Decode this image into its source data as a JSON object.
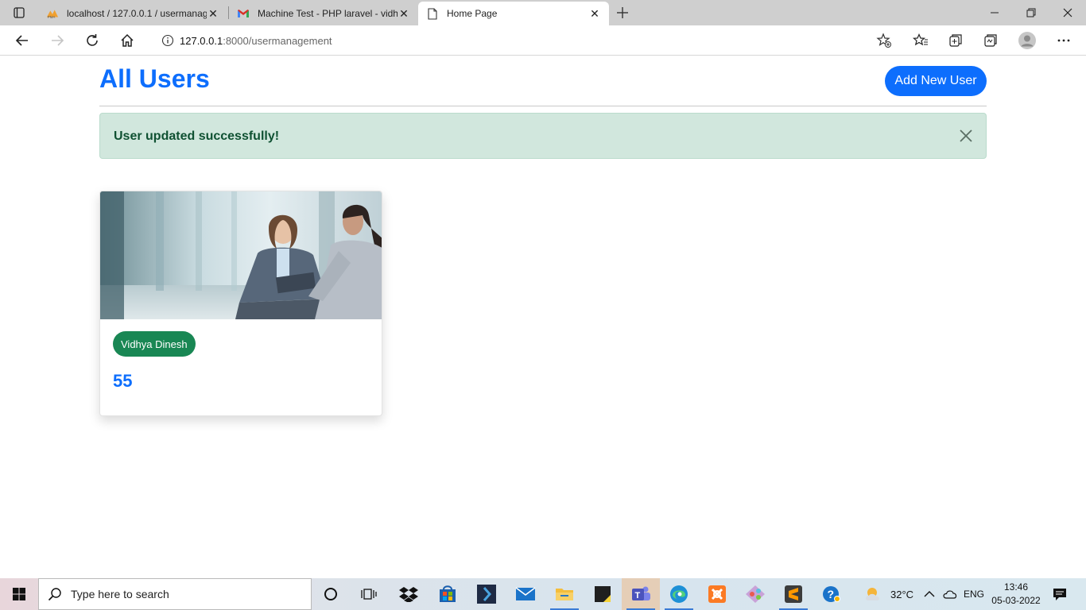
{
  "browser": {
    "tabs": [
      {
        "title": "localhost / 127.0.0.1 / usermanag",
        "icon": "phpmyadmin-icon",
        "active": false
      },
      {
        "title": "Machine Test - PHP laravel - vidh",
        "icon": "gmail-icon",
        "active": false
      },
      {
        "title": "Home Page",
        "icon": "page-icon",
        "active": true
      }
    ],
    "address": {
      "host": "127.0.0.1",
      "path": ":8000/usermanagement"
    }
  },
  "page": {
    "title": "All Users",
    "add_button": "Add New User",
    "alert": "User updated successfully!",
    "users": [
      {
        "name": "Vidhya Dinesh",
        "number": "55"
      }
    ]
  },
  "taskbar": {
    "search_placeholder": "Type here to search",
    "weather": "32°C",
    "language": "ENG",
    "time": "13:46",
    "date": "05-03-2022"
  },
  "colors": {
    "primary": "#0d6efd",
    "success": "#198754",
    "alert_bg": "#d1e7dd",
    "alert_text": "#0f5132"
  }
}
